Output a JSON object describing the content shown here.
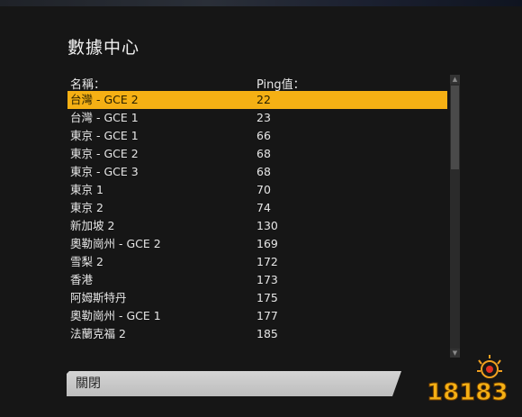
{
  "dialog": {
    "title": "數據中心",
    "columns": {
      "name": "名稱：",
      "ping": "Ping值："
    },
    "servers": [
      {
        "name": "台灣 - GCE 2",
        "ping": "22",
        "selected": true
      },
      {
        "name": "台灣 - GCE 1",
        "ping": "23"
      },
      {
        "name": "東京 - GCE 1",
        "ping": "66"
      },
      {
        "name": "東京 - GCE 2",
        "ping": "68"
      },
      {
        "name": "東京 - GCE 3",
        "ping": "68"
      },
      {
        "name": "東京 1",
        "ping": "70"
      },
      {
        "name": "東京 2",
        "ping": "74"
      },
      {
        "name": "新加坡 2",
        "ping": "130"
      },
      {
        "name": "奧勒崗州 - GCE 2",
        "ping": "169"
      },
      {
        "name": "雪梨 2",
        "ping": "172"
      },
      {
        "name": "香港",
        "ping": "173"
      },
      {
        "name": "阿姆斯特丹",
        "ping": "175"
      },
      {
        "name": "奧勒崗州 - GCE 1",
        "ping": "177"
      },
      {
        "name": "法蘭克福 2",
        "ping": "185"
      }
    ],
    "close_label": "關閉"
  },
  "watermark": {
    "text": "18183"
  },
  "colors": {
    "selected_row": "#f5b014",
    "background": "#161616",
    "button": "#c8c8c8"
  }
}
